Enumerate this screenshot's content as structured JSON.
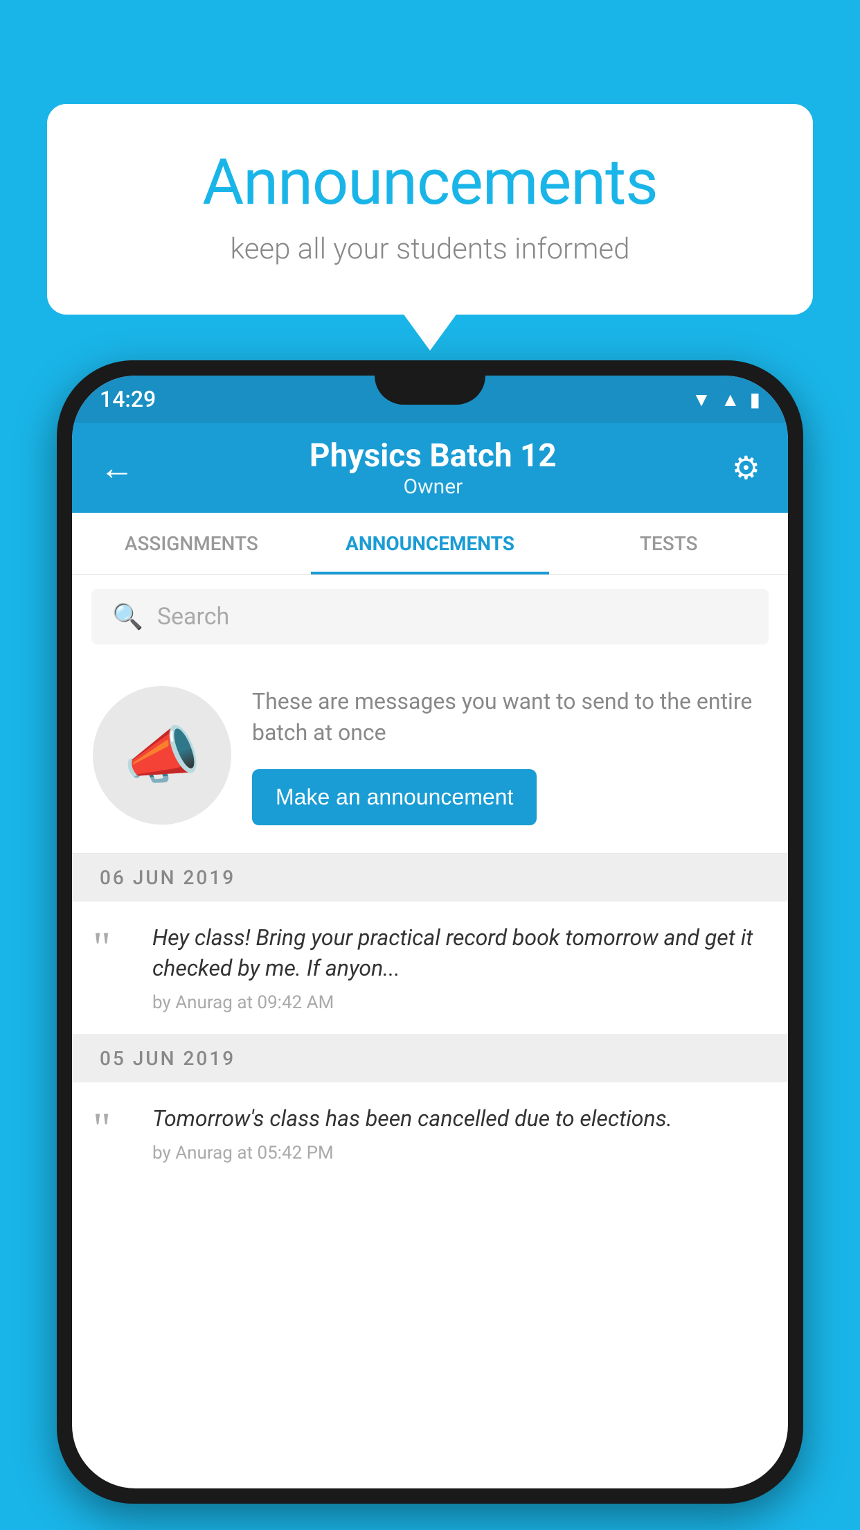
{
  "background_color": "#1ab5e8",
  "speech_bubble": {
    "title": "Announcements",
    "subtitle": "keep all your students informed"
  },
  "phone": {
    "status_bar": {
      "time": "14:29"
    },
    "app_bar": {
      "title": "Physics Batch 12",
      "subtitle": "Owner",
      "back_label": "←",
      "gear_label": "⚙"
    },
    "tabs": [
      {
        "label": "ASSIGNMENTS",
        "active": false
      },
      {
        "label": "ANNOUNCEMENTS",
        "active": true
      },
      {
        "label": "TESTS",
        "active": false
      }
    ],
    "search": {
      "placeholder": "Search"
    },
    "promo": {
      "text": "These are messages you want to send to the entire batch at once",
      "button_label": "Make an announcement"
    },
    "announcements": [
      {
        "date": "06  JUN  2019",
        "text": "Hey class! Bring your practical record book tomorrow and get it checked by me. If anyon...",
        "meta": "by Anurag at 09:42 AM"
      },
      {
        "date": "05  JUN  2019",
        "text": "Tomorrow's class has been cancelled due to elections.",
        "meta": "by Anurag at 05:42 PM"
      }
    ]
  }
}
